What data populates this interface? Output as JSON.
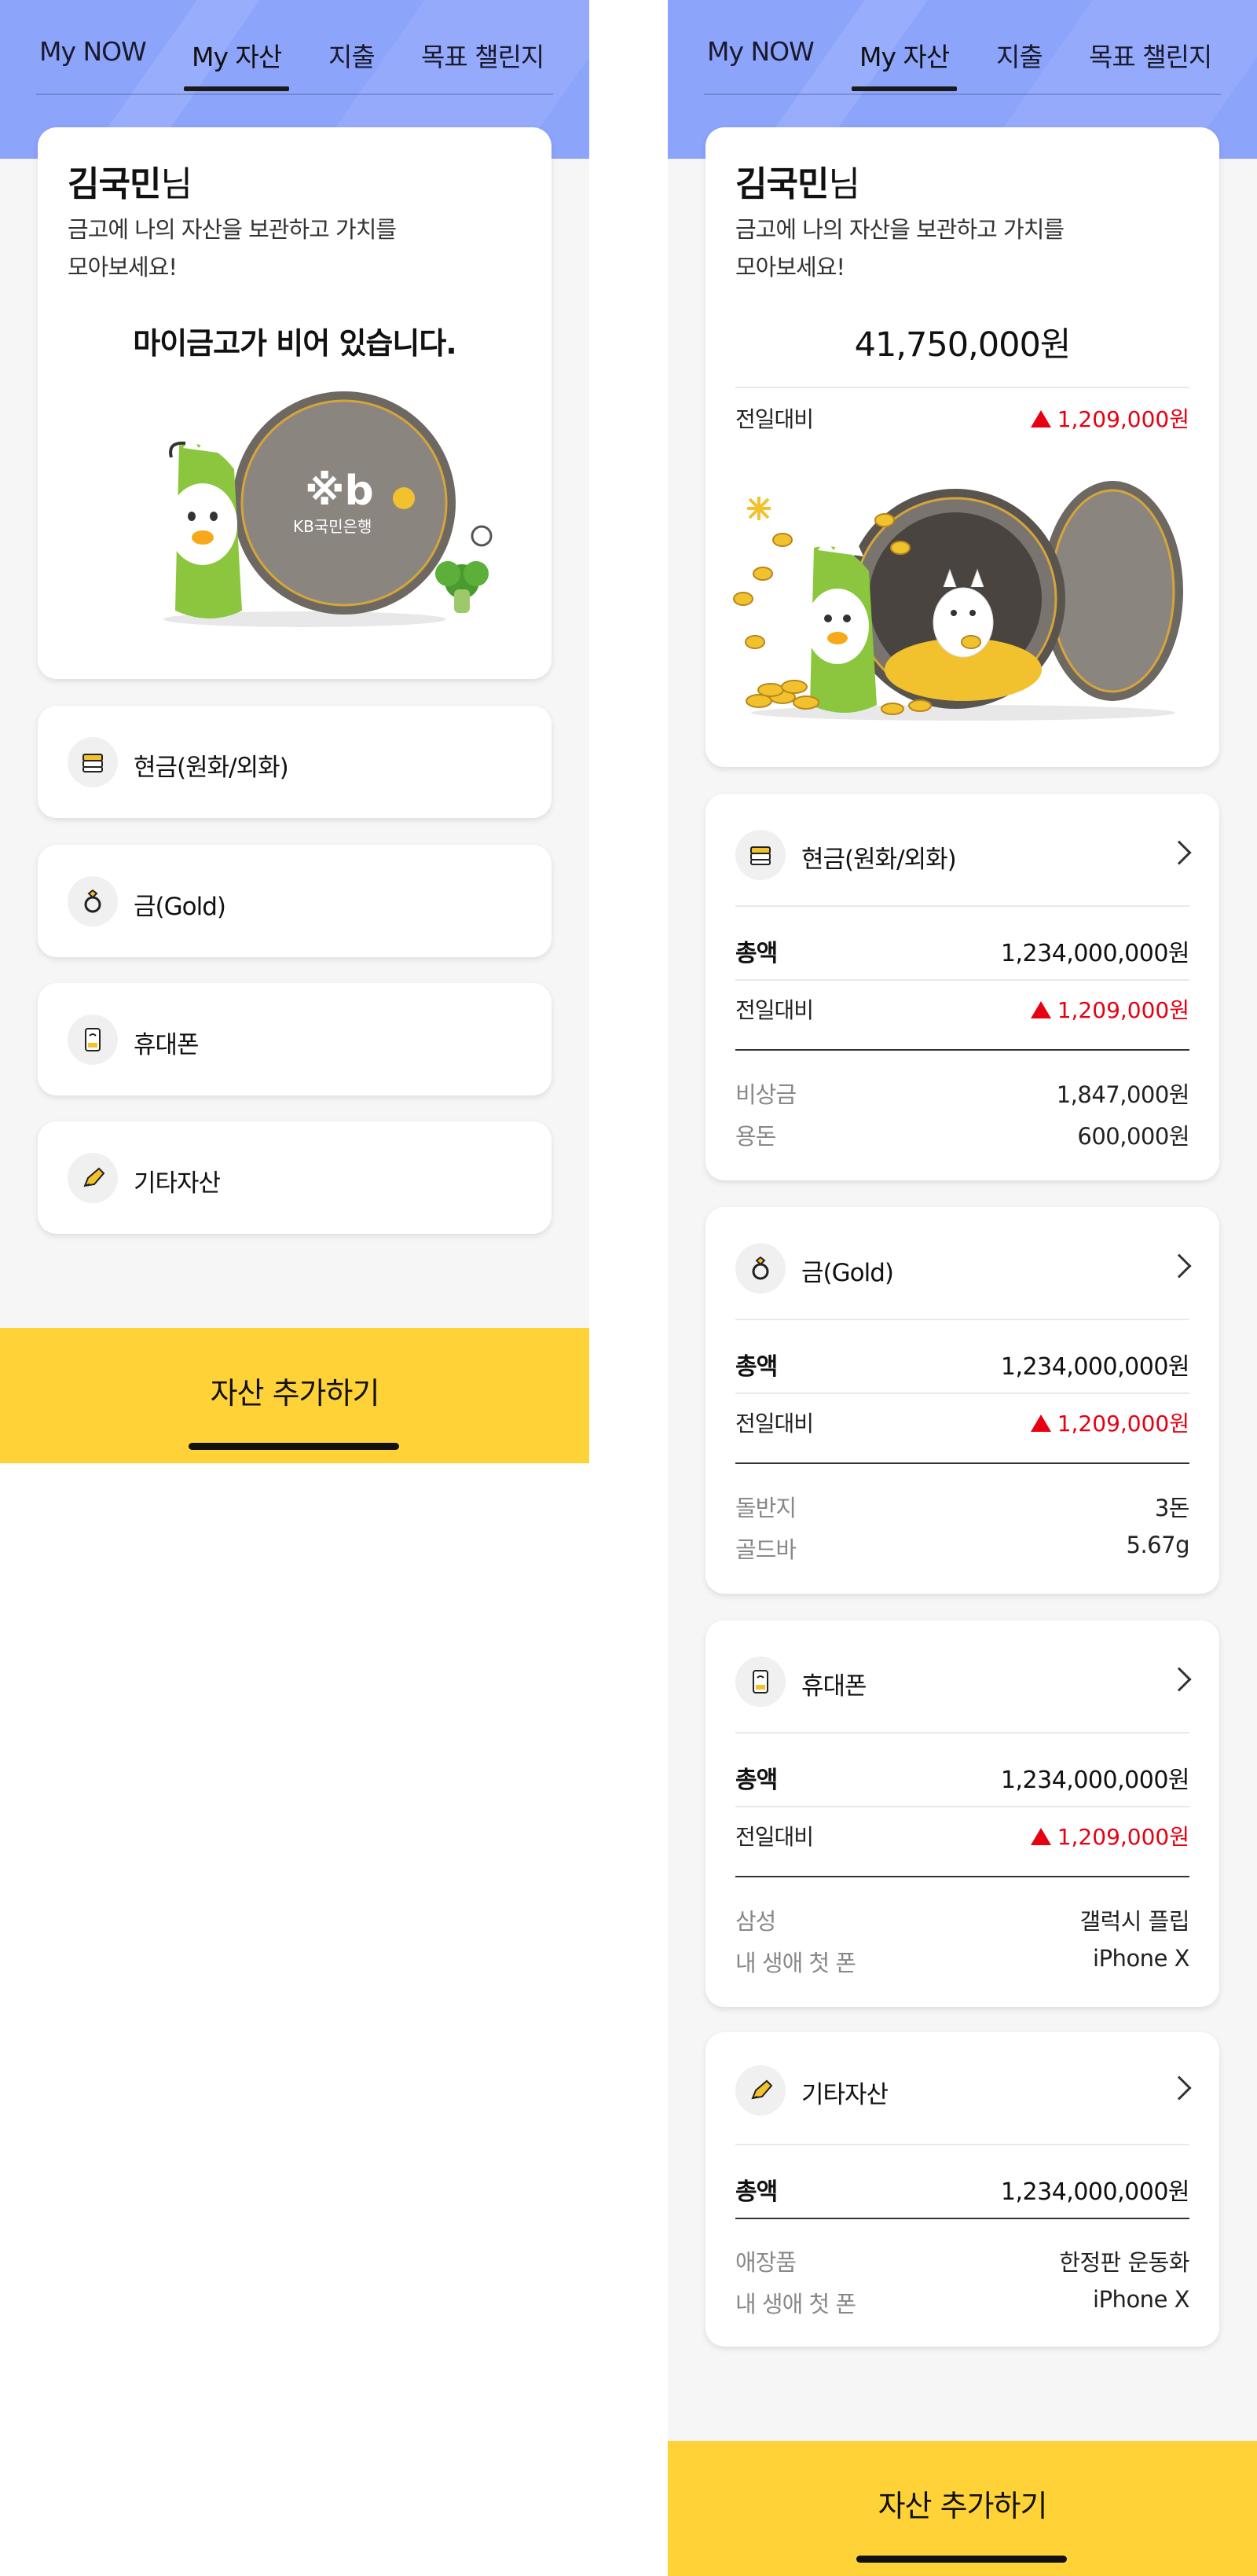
{
  "tabs": [
    "My NOW",
    "My 자산",
    "지출",
    "목표 챌린지"
  ],
  "active_tab": "My 자산",
  "greeting": {
    "name": "김국민",
    "suffix": "님",
    "line1": "금고에 나의 자산을 보관하고 가치를",
    "line2": "모아보세요!"
  },
  "empty_screen": {
    "vault_message": "마이금고가 비어 있습니다.",
    "bank_logo_text": "KB국민은행",
    "categories": [
      {
        "label": "현금(원화/외화)",
        "icon": "cash-icon"
      },
      {
        "label": "금(Gold)",
        "icon": "ring-icon"
      },
      {
        "label": "휴대폰",
        "icon": "phone-icon"
      },
      {
        "label": "기타자산",
        "icon": "pen-icon"
      }
    ]
  },
  "full_screen": {
    "total": "41,750,000원",
    "change": {
      "label": "전일대비",
      "amount": "1,209,000",
      "unit": "원",
      "direction": "up"
    },
    "sections": [
      {
        "title": "현금(원화/외화)",
        "icon": "cash-icon",
        "total_label": "총액",
        "total": "1,234,000,000원",
        "change_label": "전일대비",
        "change_amount": "1,209,000",
        "change_unit": "원",
        "items": [
          {
            "label": "비상금",
            "value": "1,847,000원"
          },
          {
            "label": "용돈",
            "value": "600,000원"
          }
        ]
      },
      {
        "title": "금(Gold)",
        "icon": "ring-icon",
        "total_label": "총액",
        "total": "1,234,000,000원",
        "change_label": "전일대비",
        "change_amount": "1,209,000",
        "change_unit": "원",
        "items": [
          {
            "label": "돌반지",
            "value": "3돈"
          },
          {
            "label": "골드바",
            "value": "5.67g"
          }
        ]
      },
      {
        "title": "휴대폰",
        "icon": "phone-icon",
        "total_label": "총액",
        "total": "1,234,000,000원",
        "change_label": "전일대비",
        "change_amount": "1,209,000",
        "change_unit": "원",
        "items": [
          {
            "label": "삼성",
            "value": "갤럭시 플립"
          },
          {
            "label": "내 생애 첫 폰",
            "value": "iPhone X"
          }
        ]
      },
      {
        "title": "기타자산",
        "icon": "pen-icon",
        "total_label": "총액",
        "total": "1,234,000,000원",
        "items": [
          {
            "label": "애장품",
            "value": "한정판 운동화"
          },
          {
            "label": "내 생애 첫 폰",
            "value": "iPhone X"
          }
        ]
      }
    ]
  },
  "cta_label": "자산 추가하기",
  "colors": {
    "header": "#8da4fb",
    "accent_yellow": "#ffd338",
    "increase_red": "#e60012",
    "background": "#f6f6f6"
  }
}
